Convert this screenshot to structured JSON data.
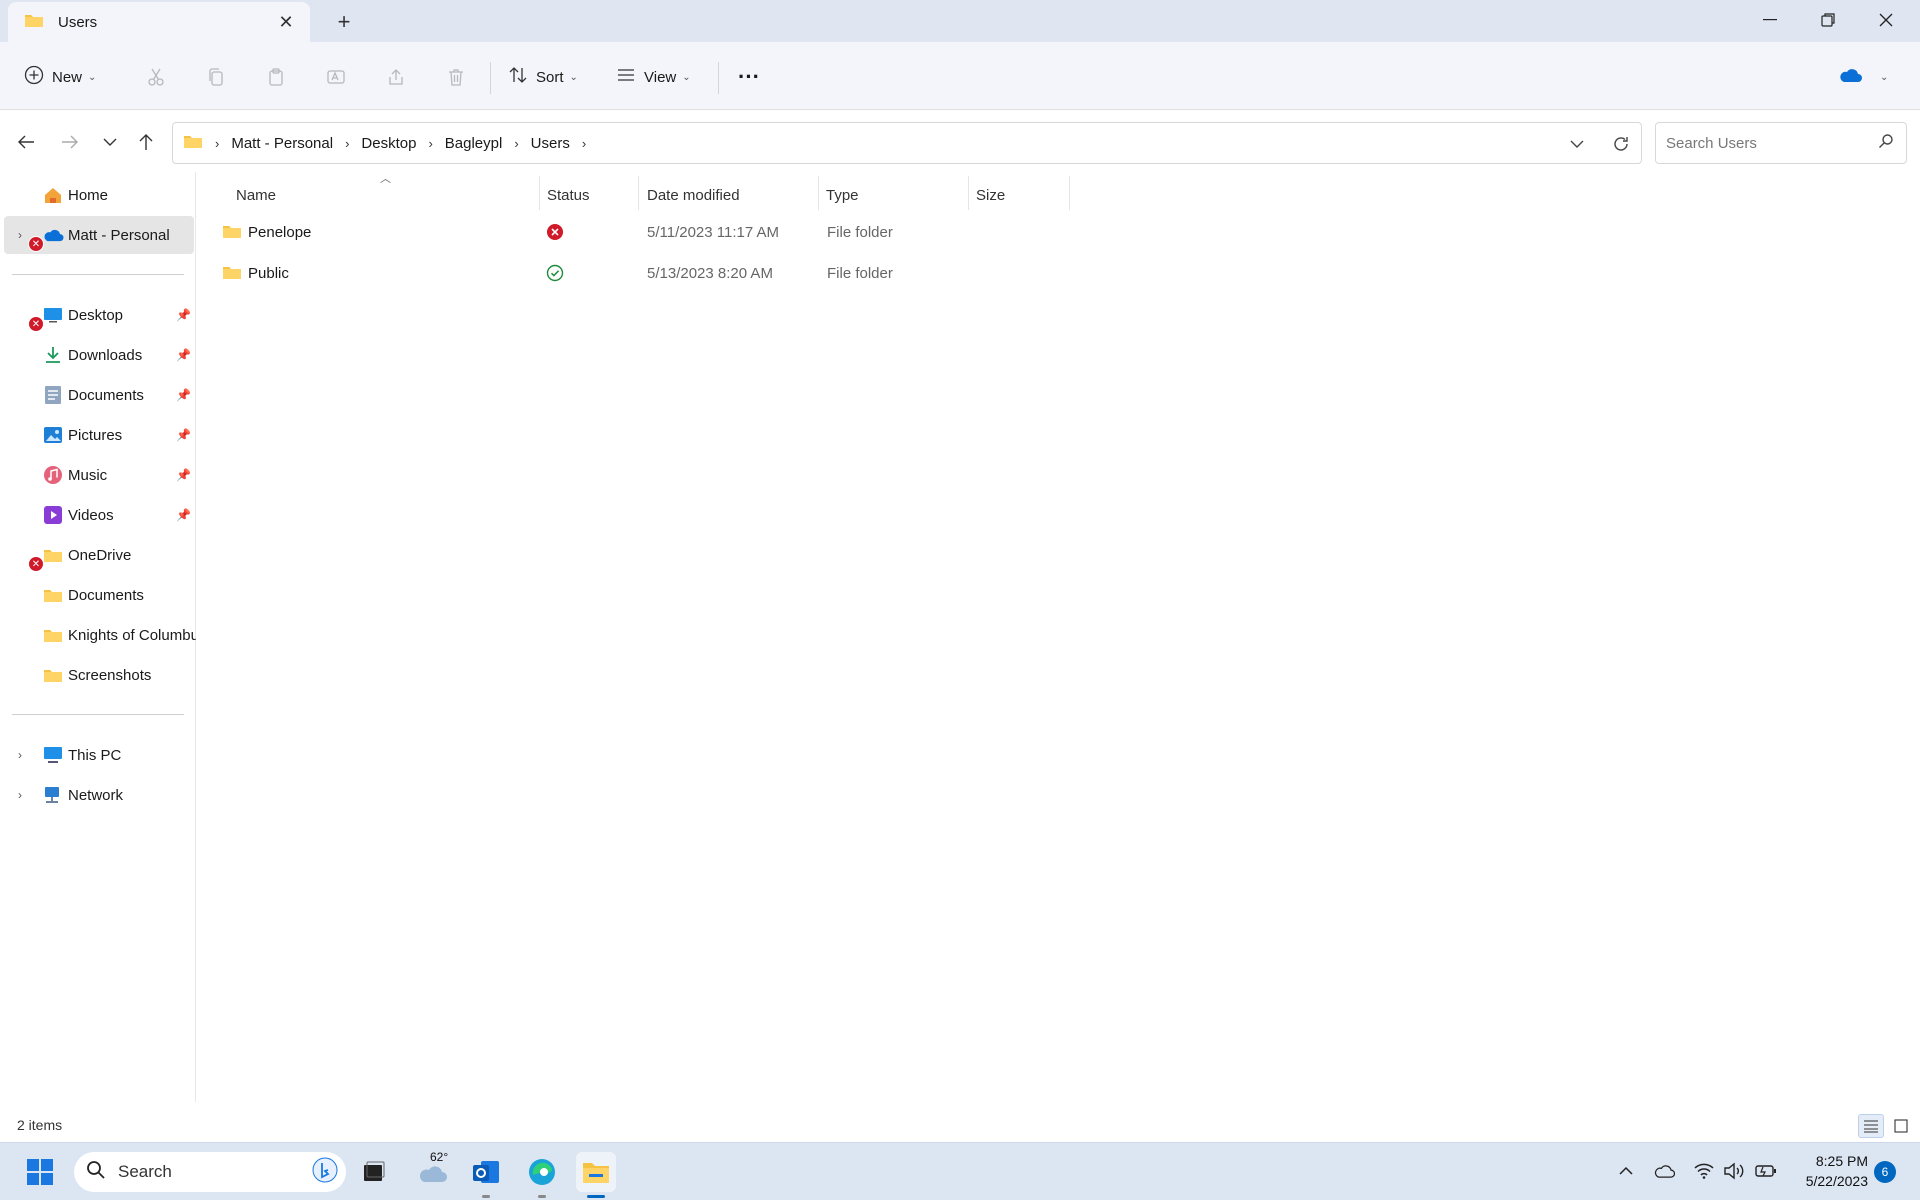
{
  "window": {
    "tab_title": "Users",
    "new_tab_symbol": "+",
    "controls": [
      "minimize-icon",
      "restore-icon",
      "close-icon"
    ]
  },
  "toolbar": {
    "new_label": "New",
    "sort_label": "Sort",
    "view_label": "View",
    "more_symbol": "···",
    "disabled_icons": [
      "cut-icon",
      "copy-icon",
      "paste-icon",
      "rename-icon",
      "share-icon",
      "delete-icon"
    ]
  },
  "address": {
    "crumbs": [
      "Matt - Personal",
      "Desktop",
      "Bagleypl",
      "Users"
    ]
  },
  "search": {
    "placeholder": "Search Users"
  },
  "sidebar": {
    "home": "Home",
    "onedrive_personal": "Matt - Personal",
    "quick_access": [
      {
        "label": "Desktop",
        "icon": "desktop-icon",
        "pinned": true,
        "sync_error": true
      },
      {
        "label": "Downloads",
        "icon": "download-icon",
        "pinned": true
      },
      {
        "label": "Documents",
        "icon": "documents-icon",
        "pinned": true
      },
      {
        "label": "Pictures",
        "icon": "pictures-icon",
        "pinned": true
      },
      {
        "label": "Music",
        "icon": "music-icon",
        "pinned": true
      },
      {
        "label": "Videos",
        "icon": "videos-icon",
        "pinned": true
      },
      {
        "label": "OneDrive",
        "icon": "folder-icon",
        "sync_error": true
      },
      {
        "label": "Documents",
        "icon": "folder-icon"
      },
      {
        "label": "Knights of Columbu",
        "icon": "folder-icon"
      },
      {
        "label": "Screenshots",
        "icon": "folder-icon"
      }
    ],
    "this_pc": "This PC",
    "network": "Network"
  },
  "columns": {
    "name": "Name",
    "status": "Status",
    "date_modified": "Date modified",
    "type": "Type",
    "size": "Size"
  },
  "files": [
    {
      "name": "Penelope",
      "status": "sync-error",
      "date_modified": "5/11/2023 11:17 AM",
      "type": "File folder",
      "size": ""
    },
    {
      "name": "Public",
      "status": "synced",
      "date_modified": "5/13/2023 8:20 AM",
      "type": "File folder",
      "size": ""
    }
  ],
  "statusbar": {
    "item_count": "2 items"
  },
  "taskbar": {
    "search_label": "Search",
    "weather_temp": "62°",
    "time": "8:25 PM",
    "date": "5/22/2023",
    "notification_count": "6"
  },
  "colors": {
    "accent": "#0067c0",
    "folder": "#f5c242",
    "error": "#d01a2a",
    "ok": "#1e8a3a"
  }
}
